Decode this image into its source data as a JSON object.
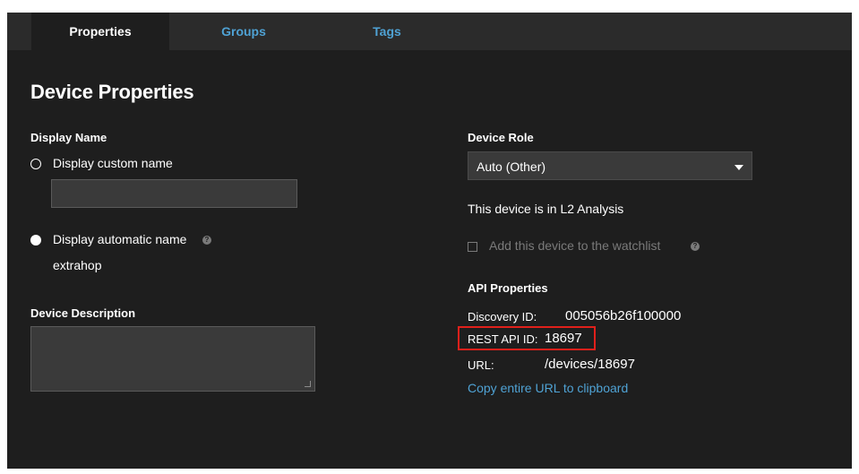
{
  "tabs": [
    {
      "label": "Properties",
      "active": true
    },
    {
      "label": "Groups",
      "active": false
    },
    {
      "label": "Tags",
      "active": false
    }
  ],
  "page_title": "Device Properties",
  "display_name": {
    "label": "Display Name",
    "custom_option": "Display custom name",
    "custom_value": "",
    "auto_option": "Display automatic name",
    "auto_value": "extrahop",
    "selected": "auto"
  },
  "device_description": {
    "label": "Device Description",
    "value": ""
  },
  "device_role": {
    "label": "Device Role",
    "selected": "Auto (Other)"
  },
  "analysis_text": "This device is in L2 Analysis",
  "watchlist": {
    "label": "Add this device to the watchlist",
    "checked": false,
    "disabled": true
  },
  "api": {
    "heading": "API Properties",
    "discovery_label": "Discovery ID:",
    "discovery_value": "005056b26f100000",
    "rest_label": "REST API ID:",
    "rest_value": "18697",
    "url_label": "URL:",
    "url_value": "/devices/18697",
    "copy_link": "Copy entire URL to clipboard"
  },
  "colors": {
    "background": "#1e1e1e",
    "tab_bar": "#2b2b2b",
    "accent_link": "#4fa2d4",
    "highlight": "#e0201b",
    "input_bg": "#3a3a3a"
  },
  "icons": [
    "help-icon",
    "caret-down-icon",
    "resize-handle-icon"
  ]
}
